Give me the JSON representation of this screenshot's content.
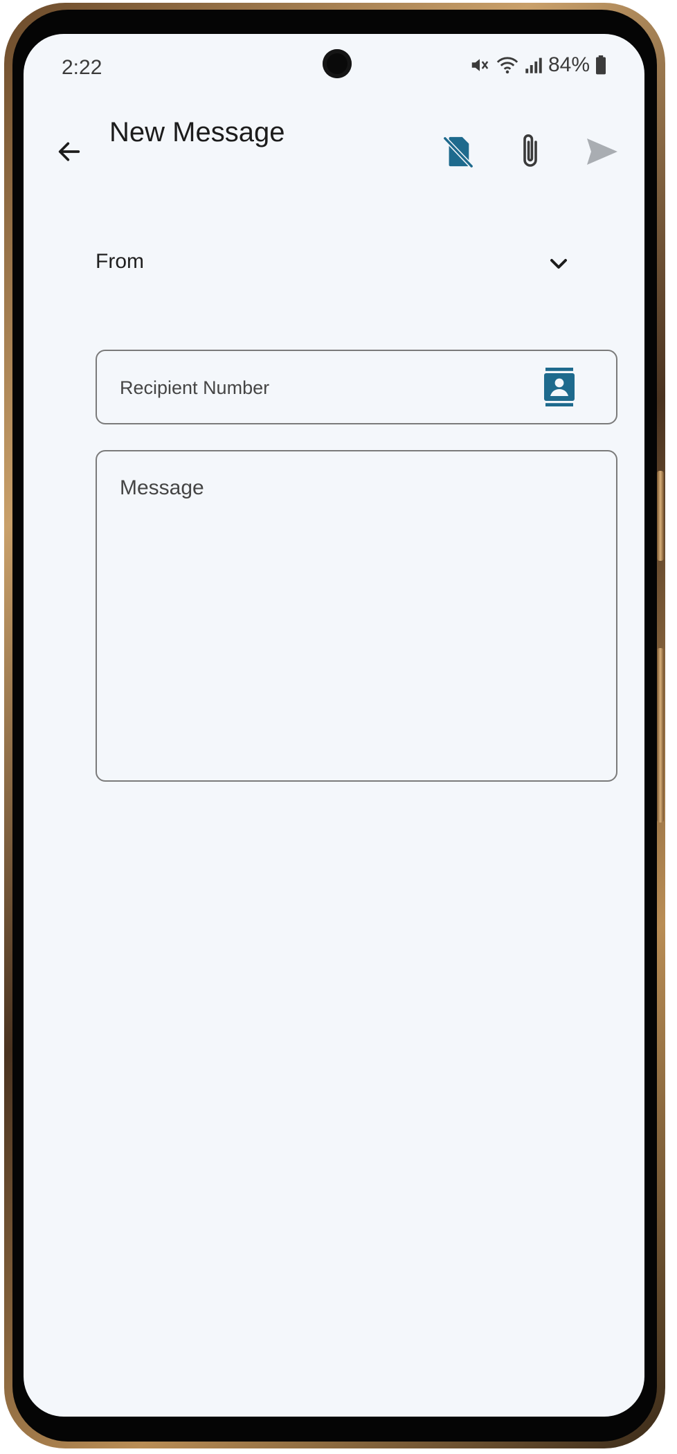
{
  "status": {
    "time": "2:22",
    "battery": "84%",
    "icons": [
      "mute-icon",
      "wifi-icon",
      "signal-icon",
      "battery-icon"
    ]
  },
  "header": {
    "title": "New Message",
    "icons": {
      "back": "back-arrow-icon",
      "sim": "no-sim-icon",
      "attach": "paperclip-icon",
      "send": "send-icon"
    }
  },
  "form": {
    "from_label": "From",
    "recipient_placeholder": "Recipient Number",
    "message_placeholder": "Message"
  },
  "colors": {
    "accent": "#1e6a8d",
    "send_disabled": "#a9adb2",
    "background": "#f4f7fb"
  }
}
